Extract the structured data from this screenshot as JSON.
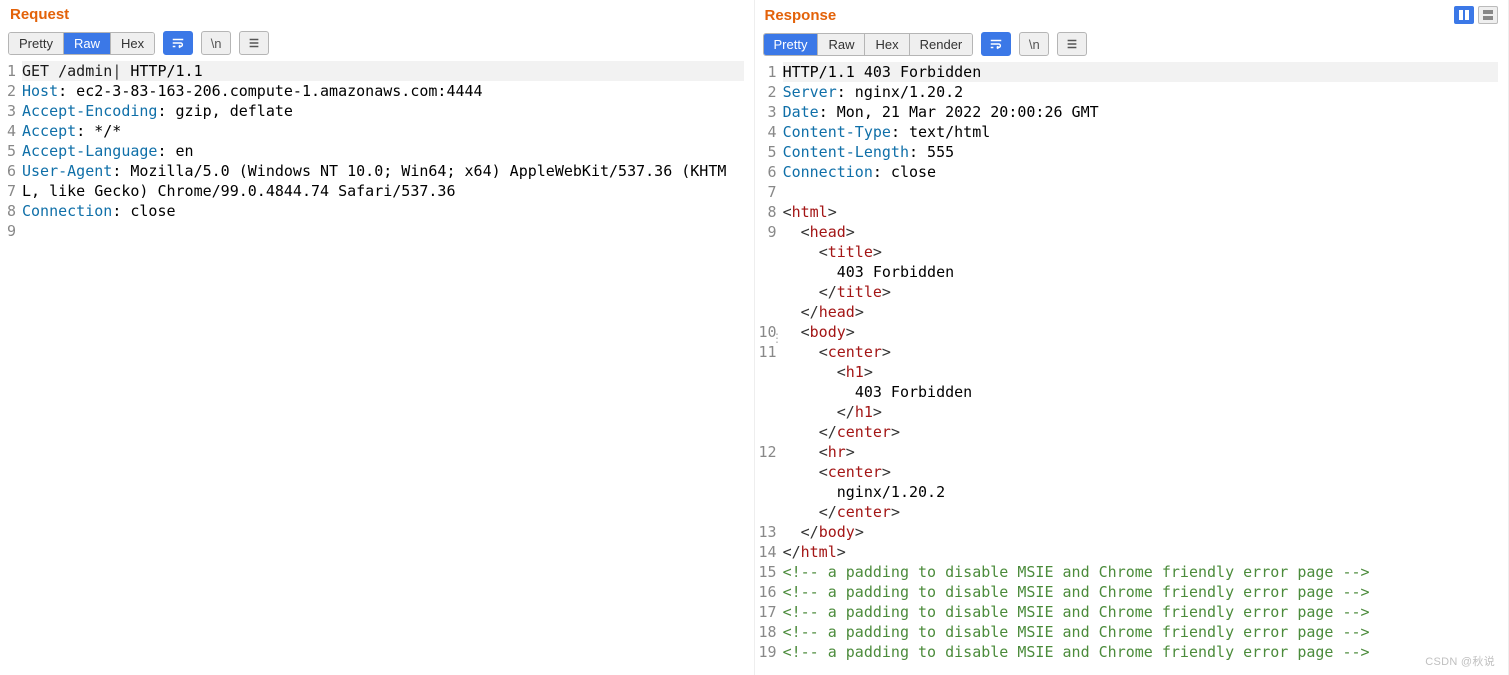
{
  "request": {
    "title": "Request",
    "tabs": {
      "pretty": "Pretty",
      "raw": "Raw",
      "hex": "Hex"
    },
    "activeTab": "raw",
    "newlineLabel": "\\n",
    "lines": [
      {
        "n": "1",
        "hl": true,
        "tokens": [
          {
            "t": "GET /admin",
            "c": "tok-method"
          },
          {
            "t": "|",
            "c": "tok-punct"
          },
          {
            "t": " HTTP/1.1",
            "c": ""
          }
        ]
      },
      {
        "n": "2",
        "tokens": [
          {
            "t": "Host",
            "c": "tok-header"
          },
          {
            "t": ": ec2-3-83-163-206.compute-1.amazonaws.com:4444",
            "c": ""
          }
        ]
      },
      {
        "n": "3",
        "tokens": [
          {
            "t": "Accept-Encoding",
            "c": "tok-header"
          },
          {
            "t": ": gzip, deflate",
            "c": ""
          }
        ]
      },
      {
        "n": "4",
        "tokens": [
          {
            "t": "Accept",
            "c": "tok-header"
          },
          {
            "t": ": */*",
            "c": ""
          }
        ]
      },
      {
        "n": "5",
        "tokens": [
          {
            "t": "Accept-Language",
            "c": "tok-header"
          },
          {
            "t": ": en",
            "c": ""
          }
        ]
      },
      {
        "n": "6",
        "tokens": [
          {
            "t": "User-Agent",
            "c": "tok-header"
          },
          {
            "t": ": Mozilla/5.0 (Windows NT 10.0; Win64; x64) AppleWebKit/537.36 (KHTML, like Gecko) Chrome/99.0.4844.74 Safari/537.36",
            "c": ""
          }
        ]
      },
      {
        "n": "7",
        "tokens": [
          {
            "t": "Connection",
            "c": "tok-header"
          },
          {
            "t": ": close",
            "c": ""
          }
        ]
      },
      {
        "n": "8",
        "tokens": [
          {
            "t": " ",
            "c": ""
          }
        ]
      },
      {
        "n": "9",
        "tokens": [
          {
            "t": " ",
            "c": ""
          }
        ]
      }
    ]
  },
  "response": {
    "title": "Response",
    "tabs": {
      "pretty": "Pretty",
      "raw": "Raw",
      "hex": "Hex",
      "render": "Render"
    },
    "activeTab": "pretty",
    "newlineLabel": "\\n",
    "lines": [
      {
        "n": "1",
        "hl": true,
        "tokens": [
          {
            "t": "HTTP/1.1 403 Forbidden",
            "c": ""
          }
        ]
      },
      {
        "n": "2",
        "tokens": [
          {
            "t": "Server",
            "c": "tok-header"
          },
          {
            "t": ": nginx/1.20.2",
            "c": ""
          }
        ]
      },
      {
        "n": "3",
        "tokens": [
          {
            "t": "Date",
            "c": "tok-header"
          },
          {
            "t": ": Mon, 21 Mar 2022 20:00:26 GMT",
            "c": ""
          }
        ]
      },
      {
        "n": "4",
        "tokens": [
          {
            "t": "Content-Type",
            "c": "tok-header"
          },
          {
            "t": ": text/html",
            "c": ""
          }
        ]
      },
      {
        "n": "5",
        "tokens": [
          {
            "t": "Content-Length",
            "c": "tok-header"
          },
          {
            "t": ": 555",
            "c": ""
          }
        ]
      },
      {
        "n": "6",
        "tokens": [
          {
            "t": "Connection",
            "c": "tok-header"
          },
          {
            "t": ": close",
            "c": ""
          }
        ]
      },
      {
        "n": "7",
        "tokens": [
          {
            "t": " ",
            "c": ""
          }
        ]
      },
      {
        "n": "8",
        "tokens": [
          {
            "t": "<",
            "c": "tok-punct"
          },
          {
            "t": "html",
            "c": "tok-tag"
          },
          {
            "t": ">",
            "c": "tok-punct"
          }
        ]
      },
      {
        "n": "9",
        "tokens": [
          {
            "t": "  <",
            "c": "tok-punct"
          },
          {
            "t": "head",
            "c": "tok-tag"
          },
          {
            "t": ">",
            "c": "tok-punct"
          }
        ]
      },
      {
        "n": "",
        "tokens": [
          {
            "t": "    <",
            "c": "tok-punct"
          },
          {
            "t": "title",
            "c": "tok-tag"
          },
          {
            "t": ">",
            "c": "tok-punct"
          }
        ]
      },
      {
        "n": "",
        "tokens": [
          {
            "t": "      403 Forbidden",
            "c": ""
          }
        ]
      },
      {
        "n": "",
        "tokens": [
          {
            "t": "    </",
            "c": "tok-punct"
          },
          {
            "t": "title",
            "c": "tok-tag"
          },
          {
            "t": ">",
            "c": "tok-punct"
          }
        ]
      },
      {
        "n": "",
        "tokens": [
          {
            "t": "  </",
            "c": "tok-punct"
          },
          {
            "t": "head",
            "c": "tok-tag"
          },
          {
            "t": ">",
            "c": "tok-punct"
          }
        ]
      },
      {
        "n": "10",
        "tokens": [
          {
            "t": "  <",
            "c": "tok-punct"
          },
          {
            "t": "body",
            "c": "tok-tag"
          },
          {
            "t": ">",
            "c": "tok-punct"
          }
        ]
      },
      {
        "n": "11",
        "tokens": [
          {
            "t": "    <",
            "c": "tok-punct"
          },
          {
            "t": "center",
            "c": "tok-tag"
          },
          {
            "t": ">",
            "c": "tok-punct"
          }
        ]
      },
      {
        "n": "",
        "tokens": [
          {
            "t": "      <",
            "c": "tok-punct"
          },
          {
            "t": "h1",
            "c": "tok-tag"
          },
          {
            "t": ">",
            "c": "tok-punct"
          }
        ]
      },
      {
        "n": "",
        "tokens": [
          {
            "t": "        403 Forbidden",
            "c": ""
          }
        ]
      },
      {
        "n": "",
        "tokens": [
          {
            "t": "      </",
            "c": "tok-punct"
          },
          {
            "t": "h1",
            "c": "tok-tag"
          },
          {
            "t": ">",
            "c": "tok-punct"
          }
        ]
      },
      {
        "n": "",
        "tokens": [
          {
            "t": "    </",
            "c": "tok-punct"
          },
          {
            "t": "center",
            "c": "tok-tag"
          },
          {
            "t": ">",
            "c": "tok-punct"
          }
        ]
      },
      {
        "n": "12",
        "tokens": [
          {
            "t": "    <",
            "c": "tok-punct"
          },
          {
            "t": "hr",
            "c": "tok-tag"
          },
          {
            "t": ">",
            "c": "tok-punct"
          }
        ]
      },
      {
        "n": "",
        "tokens": [
          {
            "t": "    <",
            "c": "tok-punct"
          },
          {
            "t": "center",
            "c": "tok-tag"
          },
          {
            "t": ">",
            "c": "tok-punct"
          }
        ]
      },
      {
        "n": "",
        "tokens": [
          {
            "t": "      nginx/1.20.2",
            "c": ""
          }
        ]
      },
      {
        "n": "",
        "tokens": [
          {
            "t": "    </",
            "c": "tok-punct"
          },
          {
            "t": "center",
            "c": "tok-tag"
          },
          {
            "t": ">",
            "c": "tok-punct"
          }
        ]
      },
      {
        "n": "13",
        "tokens": [
          {
            "t": "  </",
            "c": "tok-punct"
          },
          {
            "t": "body",
            "c": "tok-tag"
          },
          {
            "t": ">",
            "c": "tok-punct"
          }
        ]
      },
      {
        "n": "14",
        "tokens": [
          {
            "t": "</",
            "c": "tok-punct"
          },
          {
            "t": "html",
            "c": "tok-tag"
          },
          {
            "t": ">",
            "c": "tok-punct"
          }
        ]
      },
      {
        "n": "15",
        "tokens": [
          {
            "t": "<!-- a padding to disable MSIE and Chrome friendly error page -->",
            "c": "tok-comment"
          }
        ]
      },
      {
        "n": "16",
        "tokens": [
          {
            "t": "<!-- a padding to disable MSIE and Chrome friendly error page -->",
            "c": "tok-comment"
          }
        ]
      },
      {
        "n": "17",
        "tokens": [
          {
            "t": "<!-- a padding to disable MSIE and Chrome friendly error page -->",
            "c": "tok-comment"
          }
        ]
      },
      {
        "n": "18",
        "tokens": [
          {
            "t": "<!-- a padding to disable MSIE and Chrome friendly error page -->",
            "c": "tok-comment"
          }
        ]
      },
      {
        "n": "19",
        "tokens": [
          {
            "t": "<!-- a padding to disable MSIE and Chrome friendly error page -->",
            "c": "tok-comment"
          }
        ]
      }
    ]
  },
  "watermark": "CSDN @秋说"
}
